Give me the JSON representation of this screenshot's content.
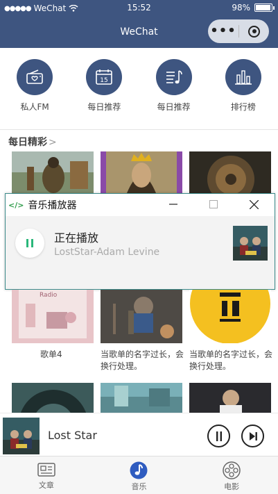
{
  "status": {
    "carrier": "WeChat",
    "time": "15:52",
    "battery": "98%"
  },
  "nav": {
    "title": "WeChat"
  },
  "categories": [
    {
      "label": "私人FM",
      "icon": "radio-icon"
    },
    {
      "label": "每日推荐",
      "icon": "calendar-icon",
      "day": "15"
    },
    {
      "label": "每日推荐",
      "icon": "music-list-icon"
    },
    {
      "label": "排行榜",
      "icon": "chart-icon"
    }
  ],
  "section": {
    "title": "每日精彩"
  },
  "window": {
    "title": "音乐播放器",
    "status": "正在播放",
    "artist": "LostStar-Adam Levine"
  },
  "cards": [
    {
      "caption": "歌单4"
    },
    {
      "caption": "当歌单的名字过长，会换行处理。"
    },
    {
      "caption": "当歌单的名字过长，会换行处理。"
    }
  ],
  "player": {
    "song": "Lost Star"
  },
  "tabs": [
    {
      "label": "文章",
      "icon": "article-icon"
    },
    {
      "label": "音乐",
      "icon": "music-icon"
    },
    {
      "label": "电影",
      "icon": "film-icon"
    }
  ],
  "colors": {
    "nav": "#3e5580",
    "accent": "#2ab77a",
    "window_border": "#3b8a8a"
  }
}
